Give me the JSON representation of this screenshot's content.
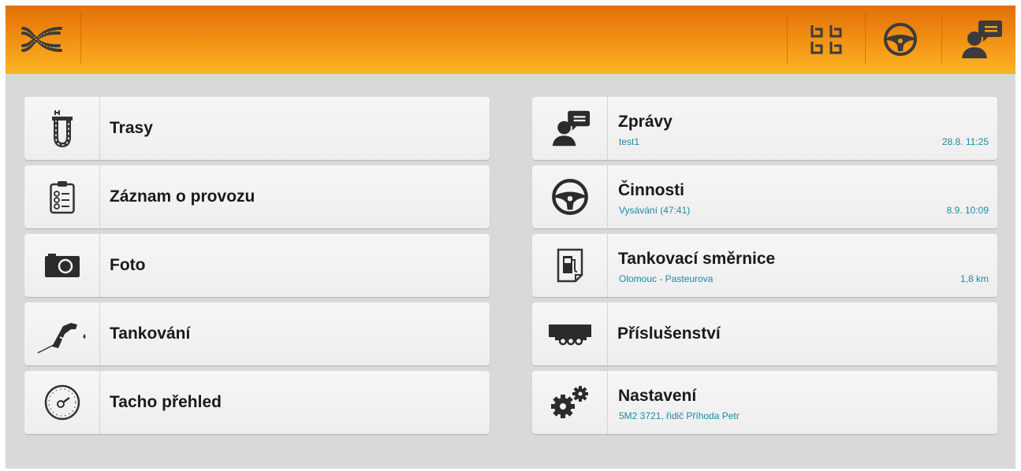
{
  "colors": {
    "header_top": "#e36f07",
    "header_bottom": "#fcb623",
    "background": "#d9d9d9",
    "tile": "#f2f2f2",
    "subtitle": "#1a8aa4",
    "text": "#1a1a1a"
  },
  "header": {
    "logo_icon": "crossed-roads-logo-icon",
    "actions": [
      {
        "icon": "grid-routes-icon"
      },
      {
        "icon": "steering-wheel-icon"
      },
      {
        "icon": "driver-messages-icon"
      }
    ]
  },
  "left_tiles": [
    {
      "icon": "route-icon",
      "label": "Trasy"
    },
    {
      "icon": "checklist-icon",
      "label": "Záznam o provozu"
    },
    {
      "icon": "camera-icon",
      "label": "Foto"
    },
    {
      "icon": "fuel-nozzle-icon",
      "label": "Tankování"
    },
    {
      "icon": "tachograph-icon",
      "label": "Tacho přehled"
    }
  ],
  "right_tiles": [
    {
      "icon": "driver-messages-icon",
      "label": "Zprávy",
      "sub": "test1",
      "meta": "28.8. 11:25"
    },
    {
      "icon": "steering-wheel-icon",
      "label": "Činnosti",
      "sub": "Vysávání (47:41)",
      "meta": "8.9. 10:09"
    },
    {
      "icon": "fuel-station-doc-icon",
      "label": "Tankovací směrnice",
      "sub": "Olomouc - Pasteurova",
      "meta": "1,8 km"
    },
    {
      "icon": "trailer-icon",
      "label": "Příslušenství"
    },
    {
      "icon": "gears-icon",
      "label": "Nastavení",
      "sub": "5M2 3721, řidič Příhoda Petr"
    }
  ]
}
